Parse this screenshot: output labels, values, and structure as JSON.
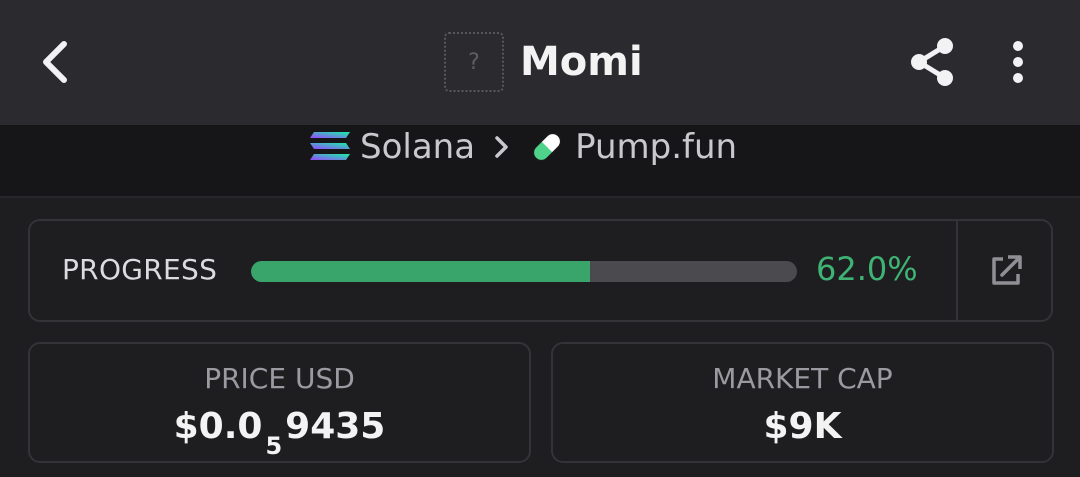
{
  "header": {
    "back_icon": "chevron-left-icon",
    "token_logo_placeholder": "?",
    "token_name": "Momi",
    "share_icon": "share-icon",
    "more_icon": "more-vertical-icon"
  },
  "breadcrumb": {
    "chain": "Solana",
    "chain_icon": "solana-logo-icon",
    "separator_icon": "chevron-right-icon",
    "platform": "Pump.fun",
    "platform_icon": "pill-icon"
  },
  "progress": {
    "label": "PROGRESS",
    "value_text": "62.0%",
    "fraction": 0.62,
    "link_icon": "external-link-icon"
  },
  "stats": {
    "price": {
      "label": "PRICE USD",
      "prefix": "$0.0",
      "zero_count": "5",
      "suffix": "9435"
    },
    "market_cap": {
      "label": "MARKET CAP",
      "value": "$9K"
    }
  },
  "colors": {
    "accent_green": "#3fb374",
    "background": "#1e1e21",
    "topbar": "#2b2b2f"
  }
}
